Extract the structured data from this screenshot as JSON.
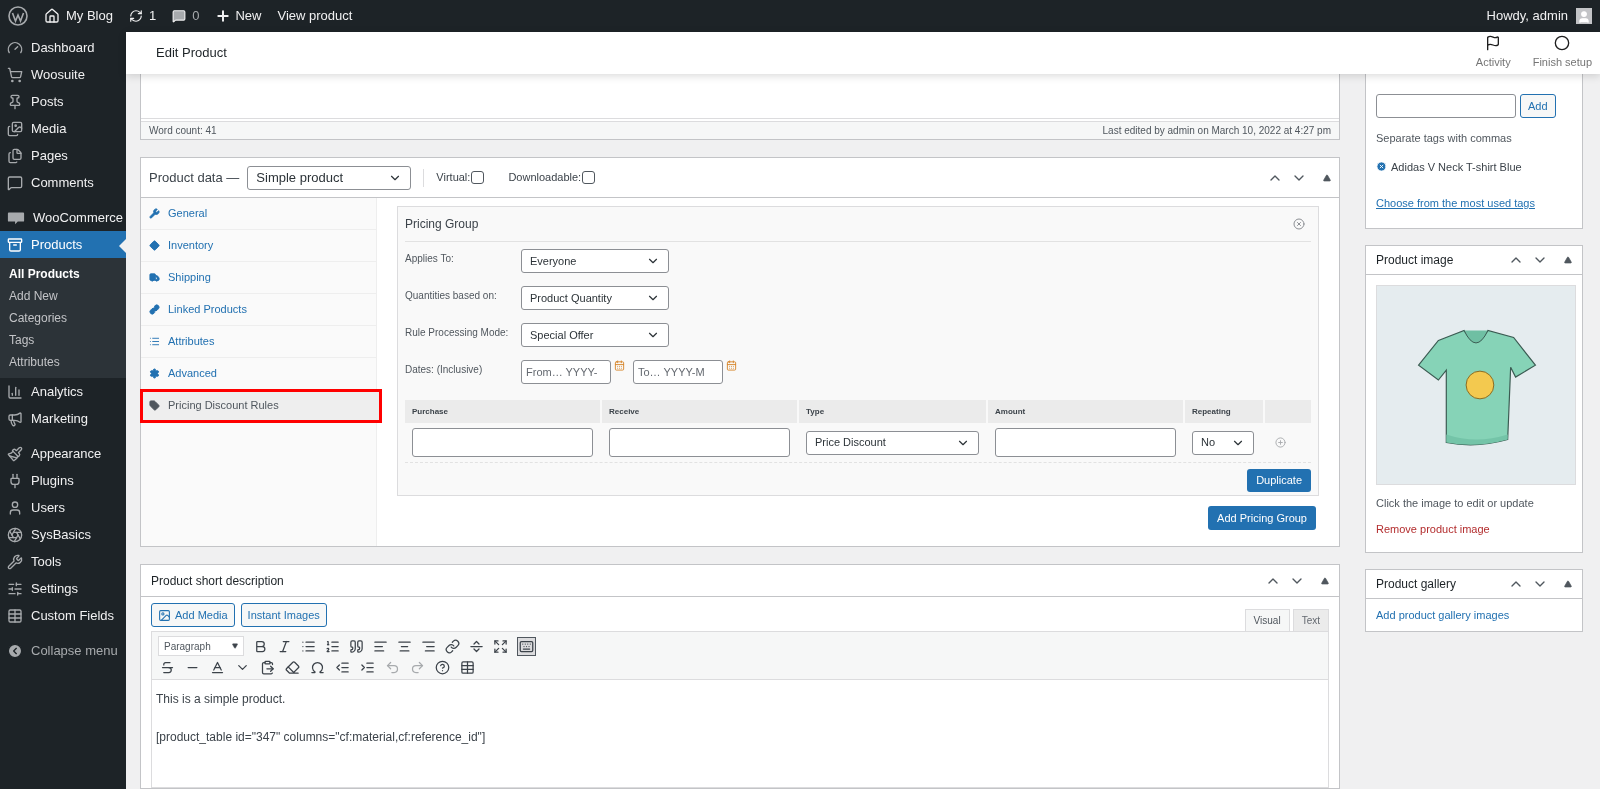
{
  "admin_bar": {
    "items": [
      {
        "kind": "logo"
      },
      {
        "kind": "home",
        "label": "My Blog"
      },
      {
        "kind": "updates",
        "label": "1"
      },
      {
        "kind": "comments",
        "label": "0"
      },
      {
        "kind": "new",
        "label": "New"
      },
      {
        "kind": "link",
        "label": "View product"
      }
    ],
    "greeting": "Howdy, admin"
  },
  "sidebar": {
    "groups": [
      [
        {
          "kind": "dashboard",
          "label": "Dashboard",
          "selected": false
        },
        {
          "kind": "woosuite",
          "label": "Woosuite",
          "selected": false
        },
        {
          "kind": "posts",
          "label": "Posts",
          "selected": false
        },
        {
          "kind": "media",
          "label": "Media",
          "selected": false
        },
        {
          "kind": "pages",
          "label": "Pages",
          "selected": false
        },
        {
          "kind": "comments",
          "label": "Comments",
          "selected": false
        }
      ],
      [
        {
          "kind": "woo",
          "label": "WooCommerce",
          "selected": false
        },
        {
          "kind": "products",
          "label": "Products",
          "selected": true,
          "children": [
            {
              "label": "All Products",
              "selected": true
            },
            {
              "label": "Add New",
              "selected": false
            },
            {
              "label": "Categories",
              "selected": false
            },
            {
              "label": "Tags",
              "selected": false
            },
            {
              "label": "Attributes",
              "selected": false
            }
          ]
        },
        {
          "kind": "analytics",
          "label": "Analytics",
          "selected": false
        },
        {
          "kind": "marketing",
          "label": "Marketing",
          "selected": false
        }
      ],
      [
        {
          "kind": "appearance",
          "label": "Appearance",
          "selected": false
        },
        {
          "kind": "plugins",
          "label": "Plugins",
          "selected": false
        },
        {
          "kind": "users",
          "label": "Users",
          "selected": false
        },
        {
          "kind": "sysbasics",
          "label": "SysBasics",
          "selected": false
        },
        {
          "kind": "tools",
          "label": "Tools",
          "selected": false
        },
        {
          "kind": "settings",
          "label": "Settings",
          "selected": false
        },
        {
          "kind": "fields",
          "label": "Custom Fields",
          "selected": false
        }
      ]
    ],
    "collapse": "Collapse menu"
  },
  "header": {
    "title": "Edit Product",
    "actions": [
      {
        "kind": "flag",
        "label": "Activity"
      },
      {
        "kind": "circle",
        "label": "Finish setup"
      }
    ]
  },
  "editor_footer": {
    "word_count": "Word count: 41",
    "last_edited": "Last edited by admin on March 10, 2022 at 4:27 pm"
  },
  "product_data": {
    "title": "Product data —",
    "type": "Simple product",
    "options": [
      {
        "label": "Virtual:",
        "checked": false
      },
      {
        "label": "Downloadable:",
        "checked": false
      }
    ],
    "tabs": [
      {
        "kind": "general",
        "label": "General",
        "selected": false,
        "highlighted": false
      },
      {
        "kind": "inventory",
        "label": "Inventory",
        "selected": false,
        "highlighted": false
      },
      {
        "kind": "shipping",
        "label": "Shipping",
        "selected": false,
        "highlighted": false
      },
      {
        "kind": "linked",
        "label": "Linked Products",
        "selected": false,
        "highlighted": false
      },
      {
        "kind": "attributes",
        "label": "Attributes",
        "selected": false,
        "highlighted": false
      },
      {
        "kind": "advanced",
        "label": "Advanced",
        "selected": false,
        "highlighted": false
      },
      {
        "kind": "tag",
        "label": "Pricing Discount Rules",
        "selected": true,
        "highlighted": true
      }
    ],
    "pricing_group": {
      "title": "Pricing Group",
      "fields": [
        {
          "label": "Applies To:",
          "value": "Everyone"
        },
        {
          "label": "Quantities based on:",
          "value": "Product Quantity"
        },
        {
          "label": "Rule Processing Mode:",
          "value": "Special Offer"
        }
      ],
      "dates": {
        "label": "Dates: (Inclusive)",
        "from_placeholder": "From… YYYY-",
        "to_placeholder": "To… YYYY-M"
      },
      "columns": [
        "Purchase",
        "Receive",
        "Type",
        "Amount",
        "Repeating"
      ],
      "rule": {
        "type": "Price Discount",
        "repeating": "No"
      },
      "duplicate": "Duplicate"
    },
    "add_group": "Add Pricing Group"
  },
  "short_description": {
    "title": "Product short description",
    "media_buttons": [
      "Add Media",
      "Instant Images"
    ],
    "editor_tabs": [
      {
        "label": "Visual",
        "selected": true
      },
      {
        "label": "Text",
        "selected": false
      }
    ],
    "format": "Paragraph",
    "paragraphs": [
      "This is a simple product.",
      "[product_table id=\"347\" columns=\"cf:material,cf:reference_id\"]"
    ]
  },
  "tags_box": {
    "button": "Add",
    "hint": "Separate tags with commas",
    "tags": [
      "Adidas V Neck T-shirt Blue"
    ],
    "link": "Choose from the most used tags"
  },
  "image_box": {
    "title": "Product image",
    "hint": "Click the image to edit or update",
    "remove": "Remove product image"
  },
  "gallery_box": {
    "title": "Product gallery",
    "link": "Add product gallery images"
  }
}
